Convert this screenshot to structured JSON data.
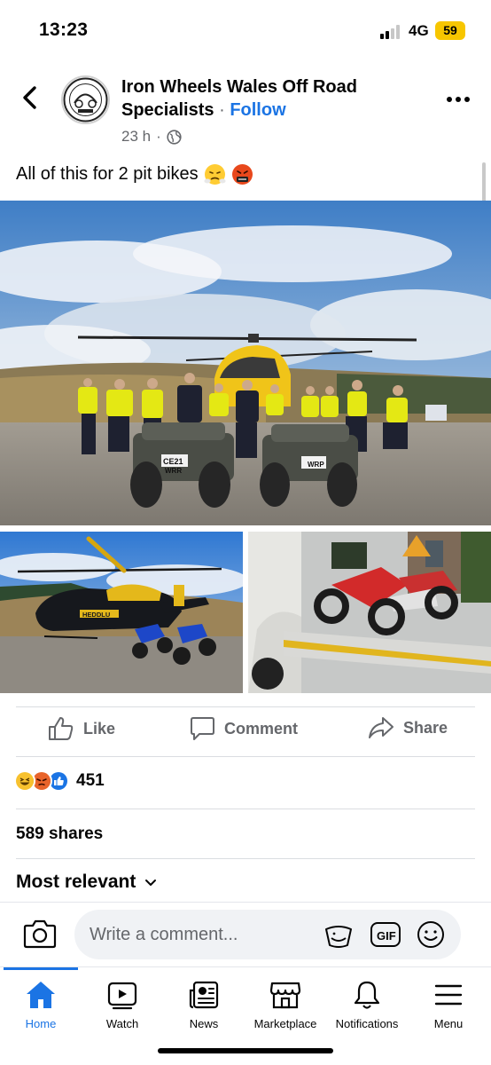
{
  "status_bar": {
    "time": "13:23",
    "network": "4G",
    "battery": "59"
  },
  "post": {
    "page_name": "Iron Wheels Wales Off Road Specialists",
    "separator": "·",
    "follow_label": "Follow",
    "time_ago": "23 h",
    "audience_icon": "globe-icon",
    "caption": "All of this for 2 pit bikes",
    "caption_emojis": [
      "face-with-steam-icon",
      "face-with-symbols-icon"
    ]
  },
  "photos": [
    {
      "name": "police-team-with-quad-bikes-and-helicopter",
      "helicopter_marking": "",
      "plates": [
        "CE21 WRR",
        "WRP"
      ]
    },
    {
      "name": "police-helicopter-with-seized-motorbikes",
      "helicopter_marking": "HEDDLU"
    },
    {
      "name": "seized-pit-bikes-on-recovery-truck"
    }
  ],
  "actions": {
    "like": "Like",
    "comment": "Comment",
    "share": "Share"
  },
  "reactions": {
    "icons": [
      "haha-icon",
      "angry-icon",
      "like-icon"
    ],
    "count": "451"
  },
  "shares": "589 shares",
  "sort": {
    "label": "Most relevant"
  },
  "composer": {
    "placeholder": "Write a comment...",
    "gif_label": "GIF"
  },
  "tabs": [
    {
      "label": "Home",
      "icon": "home-icon",
      "active": true
    },
    {
      "label": "Watch",
      "icon": "watch-icon"
    },
    {
      "label": "News",
      "icon": "news-icon"
    },
    {
      "label": "Marketplace",
      "icon": "marketplace-icon"
    },
    {
      "label": "Notifications",
      "icon": "bell-icon"
    },
    {
      "label": "Menu",
      "icon": "menu-icon"
    }
  ],
  "colors": {
    "accent": "#1b74e4",
    "secondary_text": "#65676b",
    "battery": "#f7c600"
  }
}
